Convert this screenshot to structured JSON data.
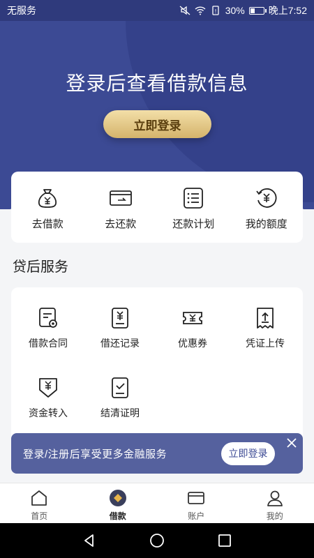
{
  "status_bar": {
    "carrier": "无服务",
    "battery": "30%",
    "time": "晚上7:52"
  },
  "hero": {
    "title": "登录后查看借款信息",
    "login_button": "立即登录"
  },
  "quick_actions": [
    {
      "label": "去借款",
      "icon": "money-bag-icon"
    },
    {
      "label": "去还款",
      "icon": "card-icon"
    },
    {
      "label": "还款计划",
      "icon": "list-icon"
    },
    {
      "label": "我的额度",
      "icon": "quota-icon"
    }
  ],
  "services": {
    "title": "贷后服务",
    "items": [
      {
        "label": "借款合同",
        "icon": "contract-icon"
      },
      {
        "label": "借还记录",
        "icon": "record-icon"
      },
      {
        "label": "优惠券",
        "icon": "coupon-icon"
      },
      {
        "label": "凭证上传",
        "icon": "upload-icon"
      },
      {
        "label": "资金转入",
        "icon": "transfer-in-icon"
      },
      {
        "label": "结清证明",
        "icon": "certificate-icon"
      }
    ]
  },
  "banner": {
    "text": "登录/注册后享受更多金融服务",
    "button": "立即登录"
  },
  "tabs": [
    {
      "label": "首页",
      "icon": "home-icon"
    },
    {
      "label": "借款",
      "icon": "loan-icon",
      "active": true
    },
    {
      "label": "账户",
      "icon": "account-card-icon"
    },
    {
      "label": "我的",
      "icon": "profile-icon"
    }
  ],
  "colors": {
    "primary": "#3c4a94",
    "gold": "#d4b36b"
  }
}
